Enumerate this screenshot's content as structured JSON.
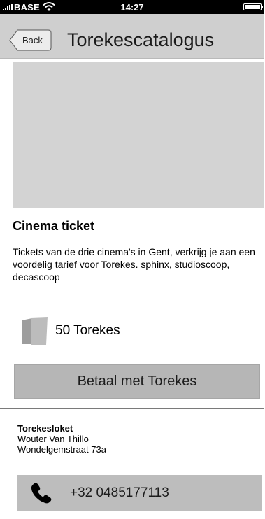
{
  "status_bar": {
    "carrier": "BASE",
    "time": "14:27",
    "signal_icon": "signal-bars-icon",
    "wifi_icon": "wifi-icon",
    "battery_icon": "battery-full-icon"
  },
  "nav": {
    "back_label": "Back",
    "title": "Torekescatalogus"
  },
  "product": {
    "title": "Cinema ticket",
    "description": "Tickets van de drie cinema's in Gent, verkrijg je aan een voordelig tarief voor Torekes. sphinx, studioscoop, decascoop",
    "price": "50 Torekes",
    "price_icon": "torekes-cards-icon",
    "pay_label": "Betaal met Torekes"
  },
  "office": {
    "name": "Torekesloket",
    "person": "Wouter Van Thillo",
    "street": "Wondelgemstraat 73a",
    "phone": "+32 0485177113",
    "phone_icon": "phone-icon"
  },
  "colors": {
    "nav_background": "#cfcfcf",
    "image_placeholder": "#d3d3d3",
    "pay_button": "#b6b6b6",
    "phone_button": "#bdbdbd"
  }
}
